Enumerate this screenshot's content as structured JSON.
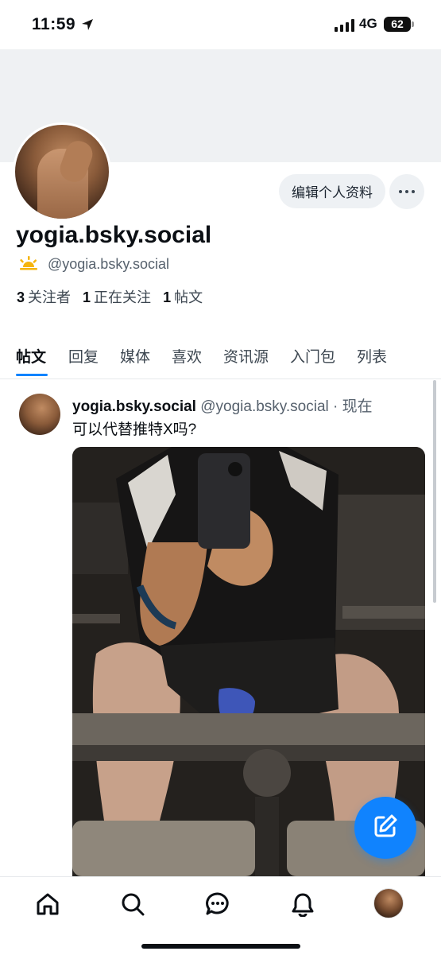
{
  "status_bar": {
    "time": "11:59",
    "network": "4G",
    "battery": "62",
    "icons": [
      "location-arrow-icon",
      "signal-bars-icon"
    ]
  },
  "profile": {
    "display_name": "yogia.bsky.social",
    "handle": "@yogia.bsky.social",
    "edit_button": "编辑个人资料",
    "more_icon": "ellipsis-icon",
    "badge_icon": "sunrise-icon",
    "stats": {
      "followers_count": "3",
      "followers_label": "关注者",
      "following_count": "1",
      "following_label": "正在关注",
      "posts_count": "1",
      "posts_label": "帖文"
    }
  },
  "tabs": [
    {
      "label": "帖文",
      "active": true
    },
    {
      "label": "回复"
    },
    {
      "label": "媒体"
    },
    {
      "label": "喜欢"
    },
    {
      "label": "资讯源"
    },
    {
      "label": "入门包"
    },
    {
      "label": "列表"
    }
  ],
  "post": {
    "author_name": "yogia.bsky.social",
    "author_handle": "@yogia.bsky.social",
    "time": "· 现在",
    "text": "可以代替推特X吗?"
  },
  "fab": {
    "icon": "compose-icon"
  },
  "bottom_nav": [
    "home-icon",
    "search-icon",
    "chat-icon",
    "bell-icon",
    "profile-avatar"
  ],
  "colors": {
    "accent": "#1083fe",
    "banner": "#eff1f3",
    "text": "#0b0f14",
    "muted": "#56616d"
  }
}
